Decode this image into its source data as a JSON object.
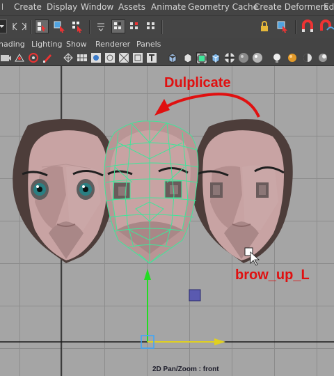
{
  "menu": {
    "items": [
      "File",
      "Create",
      "Display",
      "Window",
      "Assets",
      "Animate",
      "Geometry Cache",
      "Create Deformers",
      "Edi"
    ]
  },
  "panel_menu": {
    "items": [
      "hading",
      "Lighting",
      "Show",
      "Renderer",
      "Panels"
    ]
  },
  "viewport": {
    "annotation_title": "Dulplicate",
    "annotation_target": "brow_up_L",
    "camera_label": "2D Pan/Zoom : front",
    "annotation_color": "#e01010",
    "wireframe_color": "#3fe69a",
    "grid_color": "#8c8c8c",
    "background_color": "#a5a5a5"
  }
}
